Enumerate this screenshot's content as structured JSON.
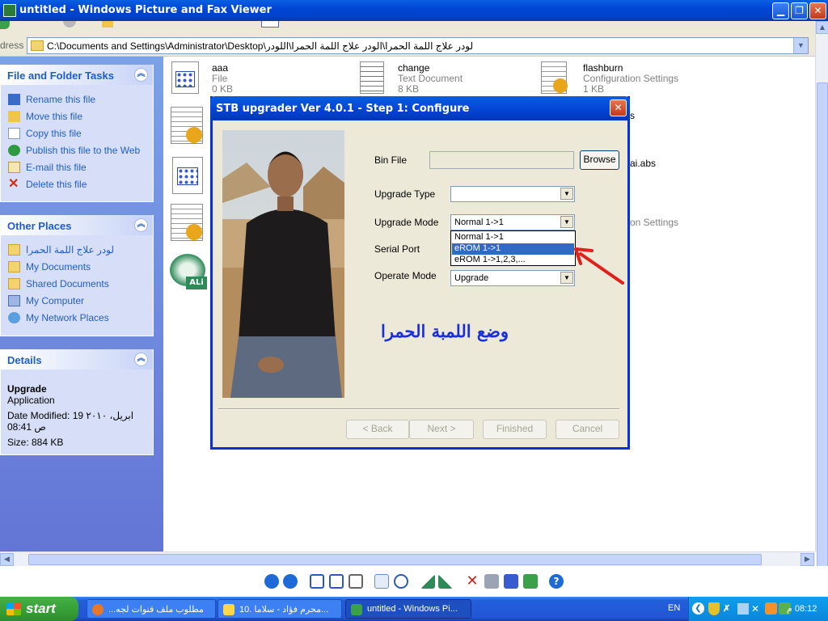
{
  "window": {
    "title": "untitled - Windows Picture and Fax Viewer"
  },
  "address": {
    "label": "dress",
    "path": "C:\\Documents and Settings\\Administrator\\Desktop\\لودر علاج اللمة الحمرا\\الودر علاج اللمة الحمرا\\اللودر"
  },
  "file_tasks": {
    "title": "File and Folder Tasks",
    "items": [
      "Rename this file",
      "Move this file",
      "Copy this file",
      "Publish this file to the Web",
      "E-mail this file",
      "Delete this file"
    ]
  },
  "other_places": {
    "title": "Other Places",
    "items": [
      "لودر علاج اللمة الحمرا",
      "My Documents",
      "Shared Documents",
      "My Computer",
      "My Network Places"
    ]
  },
  "details": {
    "title": "Details",
    "name": "Upgrade",
    "type": "Application",
    "modified_line1": "Date Modified: 19 ابريل، ٢٠١٠",
    "modified_line2": "08:41 ص",
    "size": "Size: 884 KB"
  },
  "files": [
    {
      "name": "aaa",
      "type": "File",
      "size": "0 KB"
    },
    {
      "name": "change",
      "type": "Text Document",
      "size": "8 KB"
    },
    {
      "name": "flashburn",
      "type": "Configuration Settings",
      "size": "1 KB"
    }
  ],
  "file_fragments": {
    "s": "s",
    "abs": "ai.abs",
    "settings": "on Settings"
  },
  "dialog": {
    "title": "STB upgrader Ver 4.0.1 - Step 1: Configure",
    "labels": {
      "bin_file": "Bin File",
      "upgrade_type": "Upgrade Type",
      "upgrade_mode": "Upgrade Mode",
      "serial_port": "Serial Port",
      "operate_mode": "Operate Mode"
    },
    "browse": "Browse",
    "upgrade_type_value": "",
    "upgrade_mode_value": "Normal 1->1",
    "upgrade_mode_options": [
      "Normal 1->1",
      "eROM  1->1",
      "eROM  1->1,2,3,..."
    ],
    "selected_option_index": 1,
    "operate_mode_value": "Upgrade",
    "arabic_text": "وضع اللمبة الحمرا",
    "buttons": {
      "back": "< Back",
      "next": "Next >",
      "finished": "Finished",
      "cancel": "Cancel"
    }
  },
  "taskbar": {
    "start": "start",
    "tasks": [
      "مطلوب ملف قنوات لجه...",
      "10. محرم فؤاد - سلاما...",
      "untitled - Windows Pi..."
    ],
    "lang": "EN",
    "time": "08:12 م"
  }
}
